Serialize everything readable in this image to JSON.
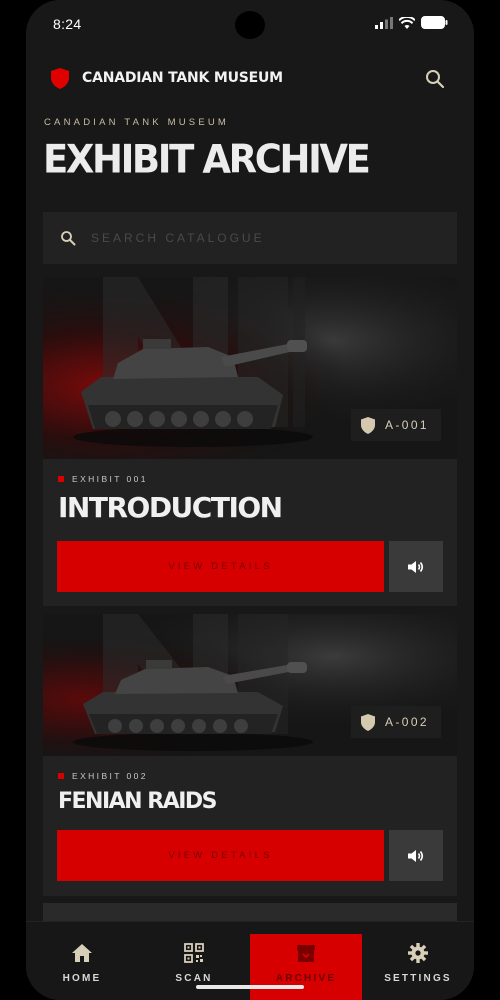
{
  "status": {
    "time": "8:24"
  },
  "header": {
    "brand": "CANADIAN TANK MUSEUM",
    "kicker": "CANADIAN TANK MUSEUM",
    "title": "EXHIBIT ARCHIVE"
  },
  "search": {
    "placeholder": "SEARCH CATALOGUE"
  },
  "exhibits": [
    {
      "code": "A-001",
      "label": "EXHIBIT 001",
      "title": "INTRODUCTION",
      "view_label": "VIEW DETAILS"
    },
    {
      "code": "A-002",
      "label": "EXHIBIT 002",
      "title": "FENIAN RAIDS",
      "view_label": "VIEW DETAILS"
    }
  ],
  "tabs": [
    {
      "label": "HOME",
      "icon": "home-icon"
    },
    {
      "label": "SCAN",
      "icon": "qr-scan-icon"
    },
    {
      "label": "ARCHIVE",
      "icon": "archive-box-icon",
      "active": true
    },
    {
      "label": "SETTINGS",
      "icon": "gear-icon"
    }
  ],
  "colors": {
    "accent": "#d60000",
    "background": "#181818",
    "card": "#222222",
    "kicker": "#c9bda4"
  }
}
